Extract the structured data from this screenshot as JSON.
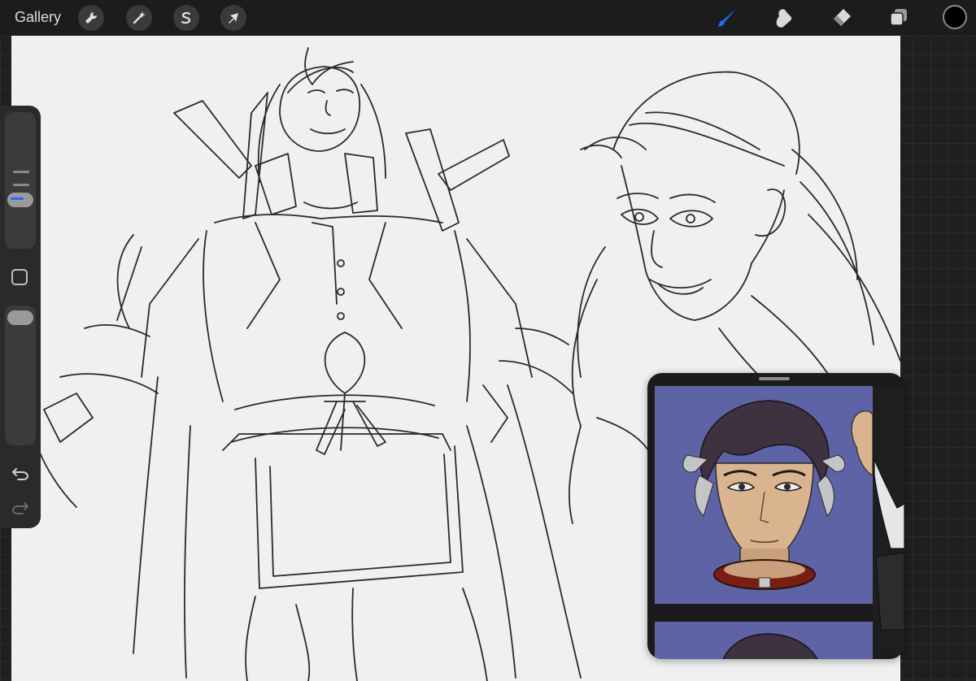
{
  "topbar": {
    "gallery_label": "Gallery",
    "left_tools": [
      {
        "name": "actions",
        "icon": "wrench-icon"
      },
      {
        "name": "adjustments",
        "icon": "magic-wand-icon"
      },
      {
        "name": "selection",
        "icon": "selection-s-icon"
      },
      {
        "name": "transform",
        "icon": "arrow-cursor-icon"
      }
    ],
    "right_tools": [
      {
        "name": "brush",
        "icon": "brush-icon",
        "active": true
      },
      {
        "name": "smudge",
        "icon": "smudge-icon"
      },
      {
        "name": "eraser",
        "icon": "eraser-icon"
      },
      {
        "name": "layers",
        "icon": "layers-icon"
      }
    ],
    "current_color": "#000000",
    "active_tool_color": "#1e6fff"
  },
  "sidebar": {
    "brush_size_icon": "brush-size-slider",
    "modify_icon": "square-modify-icon",
    "opacity_icon": "opacity-slider",
    "undo_icon": "undo-icon",
    "redo_icon": "redo-icon"
  },
  "reference": {
    "handle_icon": "drag-handle-icon",
    "background_color": "#5e63a6"
  }
}
